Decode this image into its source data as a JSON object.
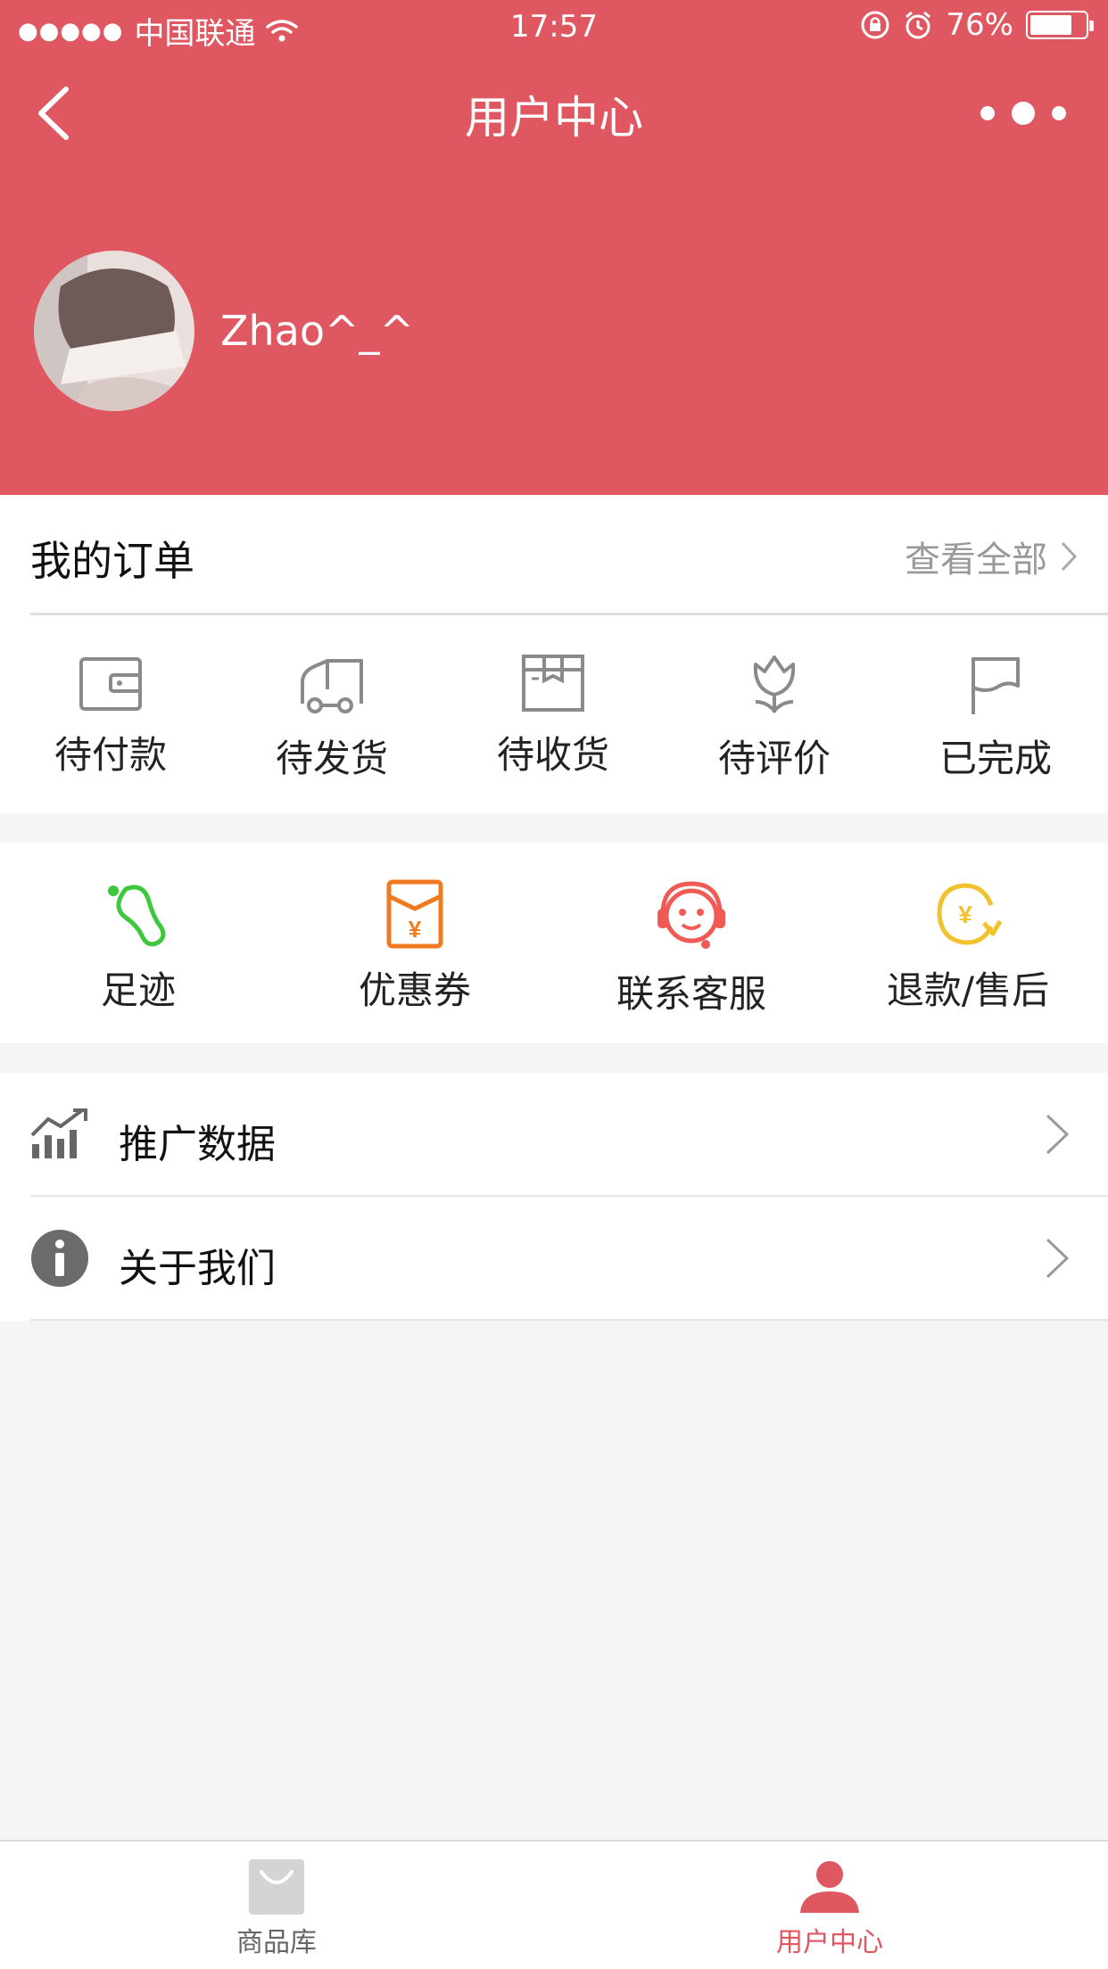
{
  "status_bar": {
    "carrier": "中国联通",
    "time": "17:57",
    "battery": "76%",
    "battery_level": 0.76
  },
  "nav": {
    "title": "用户中心",
    "back_icon": "chevron-left-icon",
    "more_icon": "more-dots-icon"
  },
  "profile": {
    "username": "Zhao^_^"
  },
  "orders": {
    "title": "我的订单",
    "view_all": "查看全部",
    "items": [
      {
        "label": "待付款",
        "icon": "wallet-icon"
      },
      {
        "label": "待发货",
        "icon": "truck-icon"
      },
      {
        "label": "待收货",
        "icon": "package-icon"
      },
      {
        "label": "待评价",
        "icon": "flower-icon"
      },
      {
        "label": "已完成",
        "icon": "flag-icon"
      }
    ]
  },
  "tools": {
    "items": [
      {
        "label": "足迹",
        "icon": "footprint-icon",
        "color": "#3dc83d"
      },
      {
        "label": "优惠券",
        "icon": "coupon-icon",
        "color": "#f07a20"
      },
      {
        "label": "联系客服",
        "icon": "headset-icon",
        "color": "#f05a55"
      },
      {
        "label": "退款/售后",
        "icon": "refund-icon",
        "color": "#f2c12e"
      }
    ]
  },
  "menu": {
    "items": [
      {
        "label": "推广数据",
        "icon": "chart-icon"
      },
      {
        "label": "关于我们",
        "icon": "info-icon"
      }
    ]
  },
  "tabbar": {
    "items": [
      {
        "label": "商品库",
        "icon": "shopping-bag-icon",
        "active": false
      },
      {
        "label": "用户中心",
        "icon": "user-icon",
        "active": true
      }
    ]
  },
  "colors": {
    "brand": "#df5760",
    "tab_active": "#df5760",
    "tab_inactive": "#666666",
    "background": "#f5f5f5"
  }
}
